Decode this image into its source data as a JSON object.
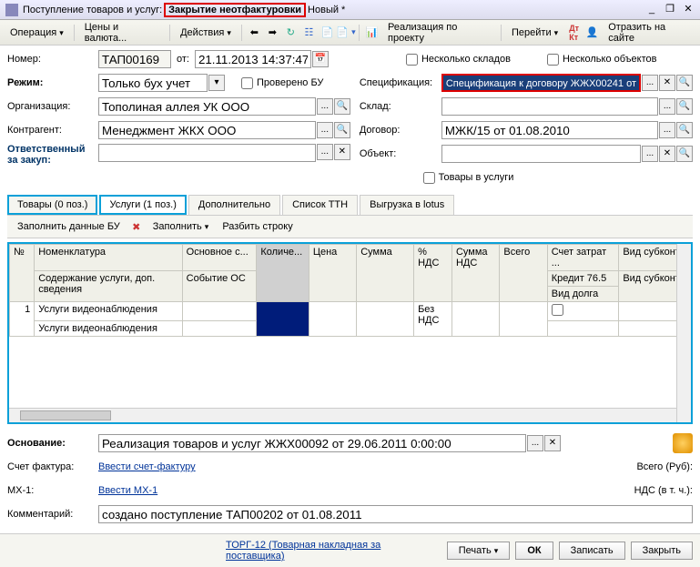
{
  "title": {
    "prefix": "Поступление товаров и услуг:",
    "highlight": "Закрытие неотфактуровки",
    "suffix": "Новый *"
  },
  "toolbar": {
    "operation": "Операция",
    "prices": "Цены и валюта...",
    "actions": "Действия",
    "realization": "Реализация по проекту",
    "goto": "Перейти",
    "publish": "Отразить на сайте"
  },
  "fields": {
    "number_lbl": "Номер:",
    "number": "ТАП00169",
    "from_lbl": "от:",
    "date": "21.11.2013 14:37:47",
    "multi_warehouse": "Несколько складов",
    "multi_objects": "Несколько объектов",
    "mode_lbl": "Режим:",
    "mode": "Только бух учет",
    "checked_bu": "Проверено БУ",
    "spec_lbl": "Спецификация:",
    "spec_val": "Спецификация к договору ЖЖХ00241 от",
    "org_lbl": "Организация:",
    "org": "Тополиная аллея УК ООО",
    "warehouse_lbl": "Склад:",
    "contragent_lbl": "Контрагент:",
    "contragent": "Менеджмент ЖКХ ООО",
    "contract_lbl": "Договор:",
    "contract": "МЖК/15 от 01.08.2010",
    "responsible_lbl": "Ответственный\nза закуп:",
    "object_lbl": "Объект:",
    "goods_to_services": "Товары в услуги"
  },
  "tabs": {
    "goods": "Товары (0 поз.)",
    "services": "Услуги (1 поз.)",
    "additional": "Дополнительно",
    "ttn": "Список ТТН",
    "lotus": "Выгрузка в lotus"
  },
  "subtoolbar": {
    "fill_bu": "Заполнить данные БУ",
    "fill": "Заполнить",
    "split": "Разбить строку"
  },
  "table": {
    "headers": {
      "n": "№",
      "nom": "Номенклатура",
      "nom2": "Содержание услуги, доп. сведения",
      "os": "Основное с...",
      "os2": "Событие ОС",
      "qty": "Количе...",
      "price": "Цена",
      "sum": "Сумма",
      "nds_pct": "% НДС",
      "nds_sum": "Сумма НДС",
      "total": "Всего",
      "acct": "Счет затрат ...",
      "acct2": "Кредит 76.5",
      "acct3": "Вид долга",
      "sub": "Вид субконто",
      "sub2": "Вид субконто"
    },
    "rows": [
      {
        "n": "1",
        "nom": "Услуги видеонаблюдения",
        "nom2": "Услуги видеонаблюдения",
        "nds": "Без НДС"
      }
    ]
  },
  "bottom": {
    "basis_lbl": "Основание:",
    "basis": "Реализация товаров и услуг ЖЖХ00092 от 29.06.2011 0:00:00",
    "invoice_lbl": "Счет фактура:",
    "invoice_link": "Ввести счет-фактуру",
    "mx_lbl": "МХ-1:",
    "mx_link": "Ввести МХ-1",
    "comment_lbl": "Комментарий:",
    "comment": "создано поступление ТАП00202 от 01.08.2011",
    "total_lbl": "Всего (Руб):",
    "vat_lbl": "НДС (в т. ч.):"
  },
  "footer": {
    "torg": "ТОРГ-12 (Товарная накладная за поставщика)",
    "print": "Печать",
    "ok": "ОК",
    "save": "Записать",
    "close": "Закрыть"
  }
}
